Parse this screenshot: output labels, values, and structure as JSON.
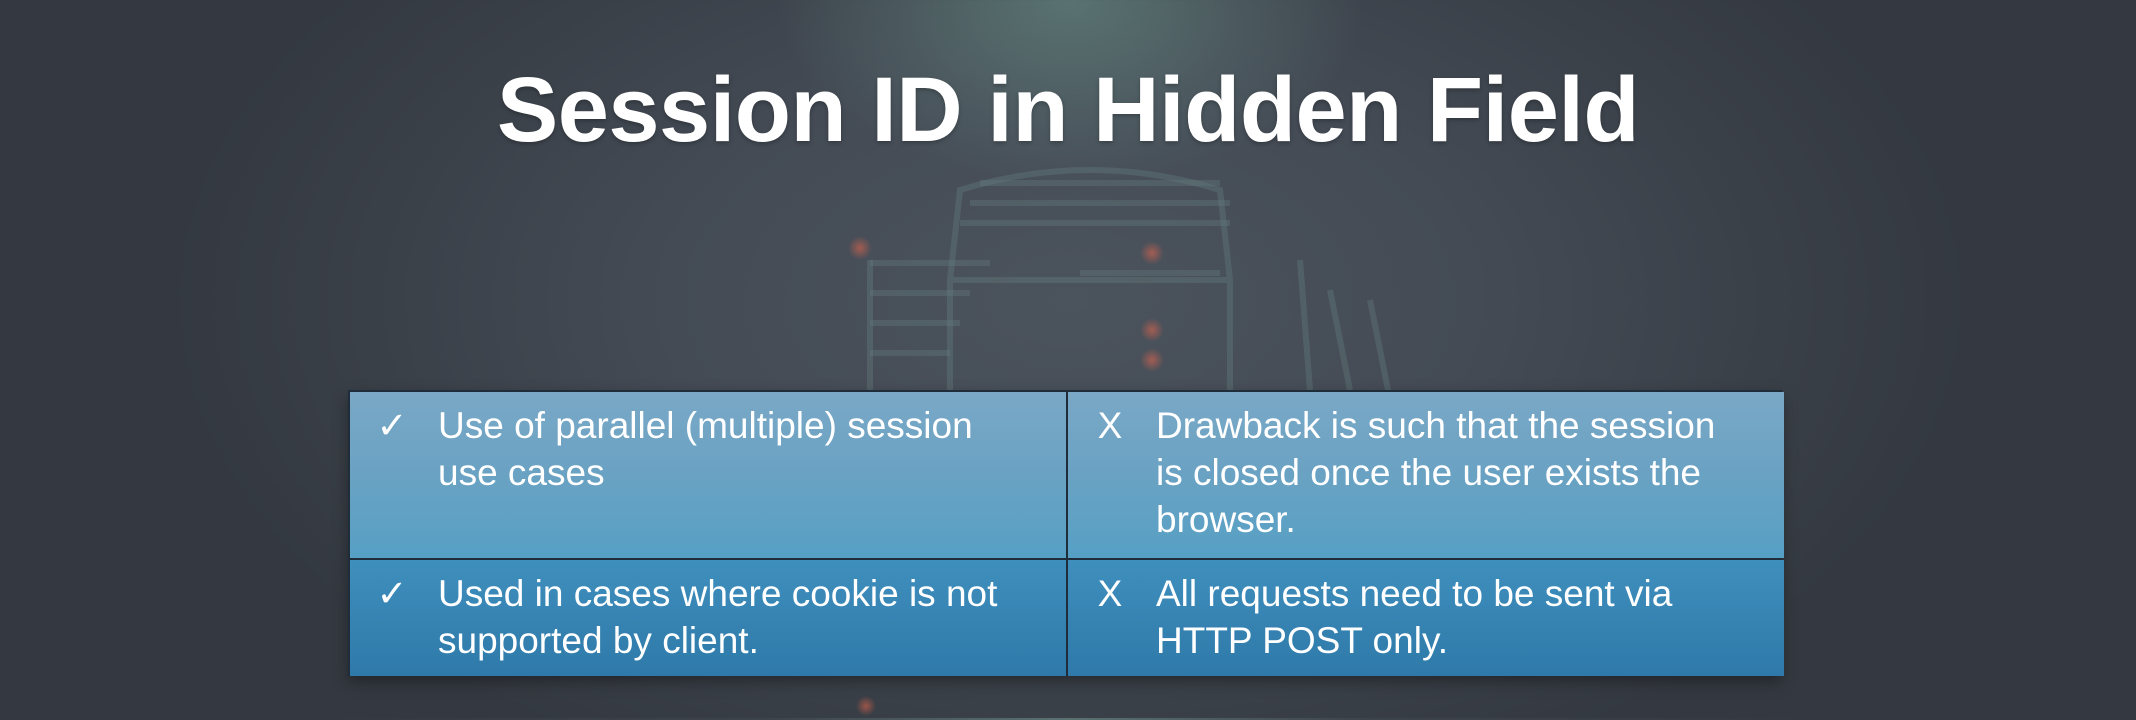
{
  "slide": {
    "title": "Session ID in Hidden Field"
  },
  "table": {
    "rows": [
      {
        "pro_mark": "✓",
        "pro_text": "Use of parallel (multiple) session use cases",
        "con_mark": "X",
        "con_text": "Drawback is such that the session is closed once the user exists the browser."
      },
      {
        "pro_mark": "✓",
        "pro_text": "Used in cases where cookie is not supported by client.",
        "con_mark": "X",
        "con_text": "All requests need to be sent via HTTP POST only."
      }
    ]
  },
  "colors": {
    "row1": "#6aa2c3",
    "row2": "#2e79a9",
    "border": "#1f2d3b"
  }
}
